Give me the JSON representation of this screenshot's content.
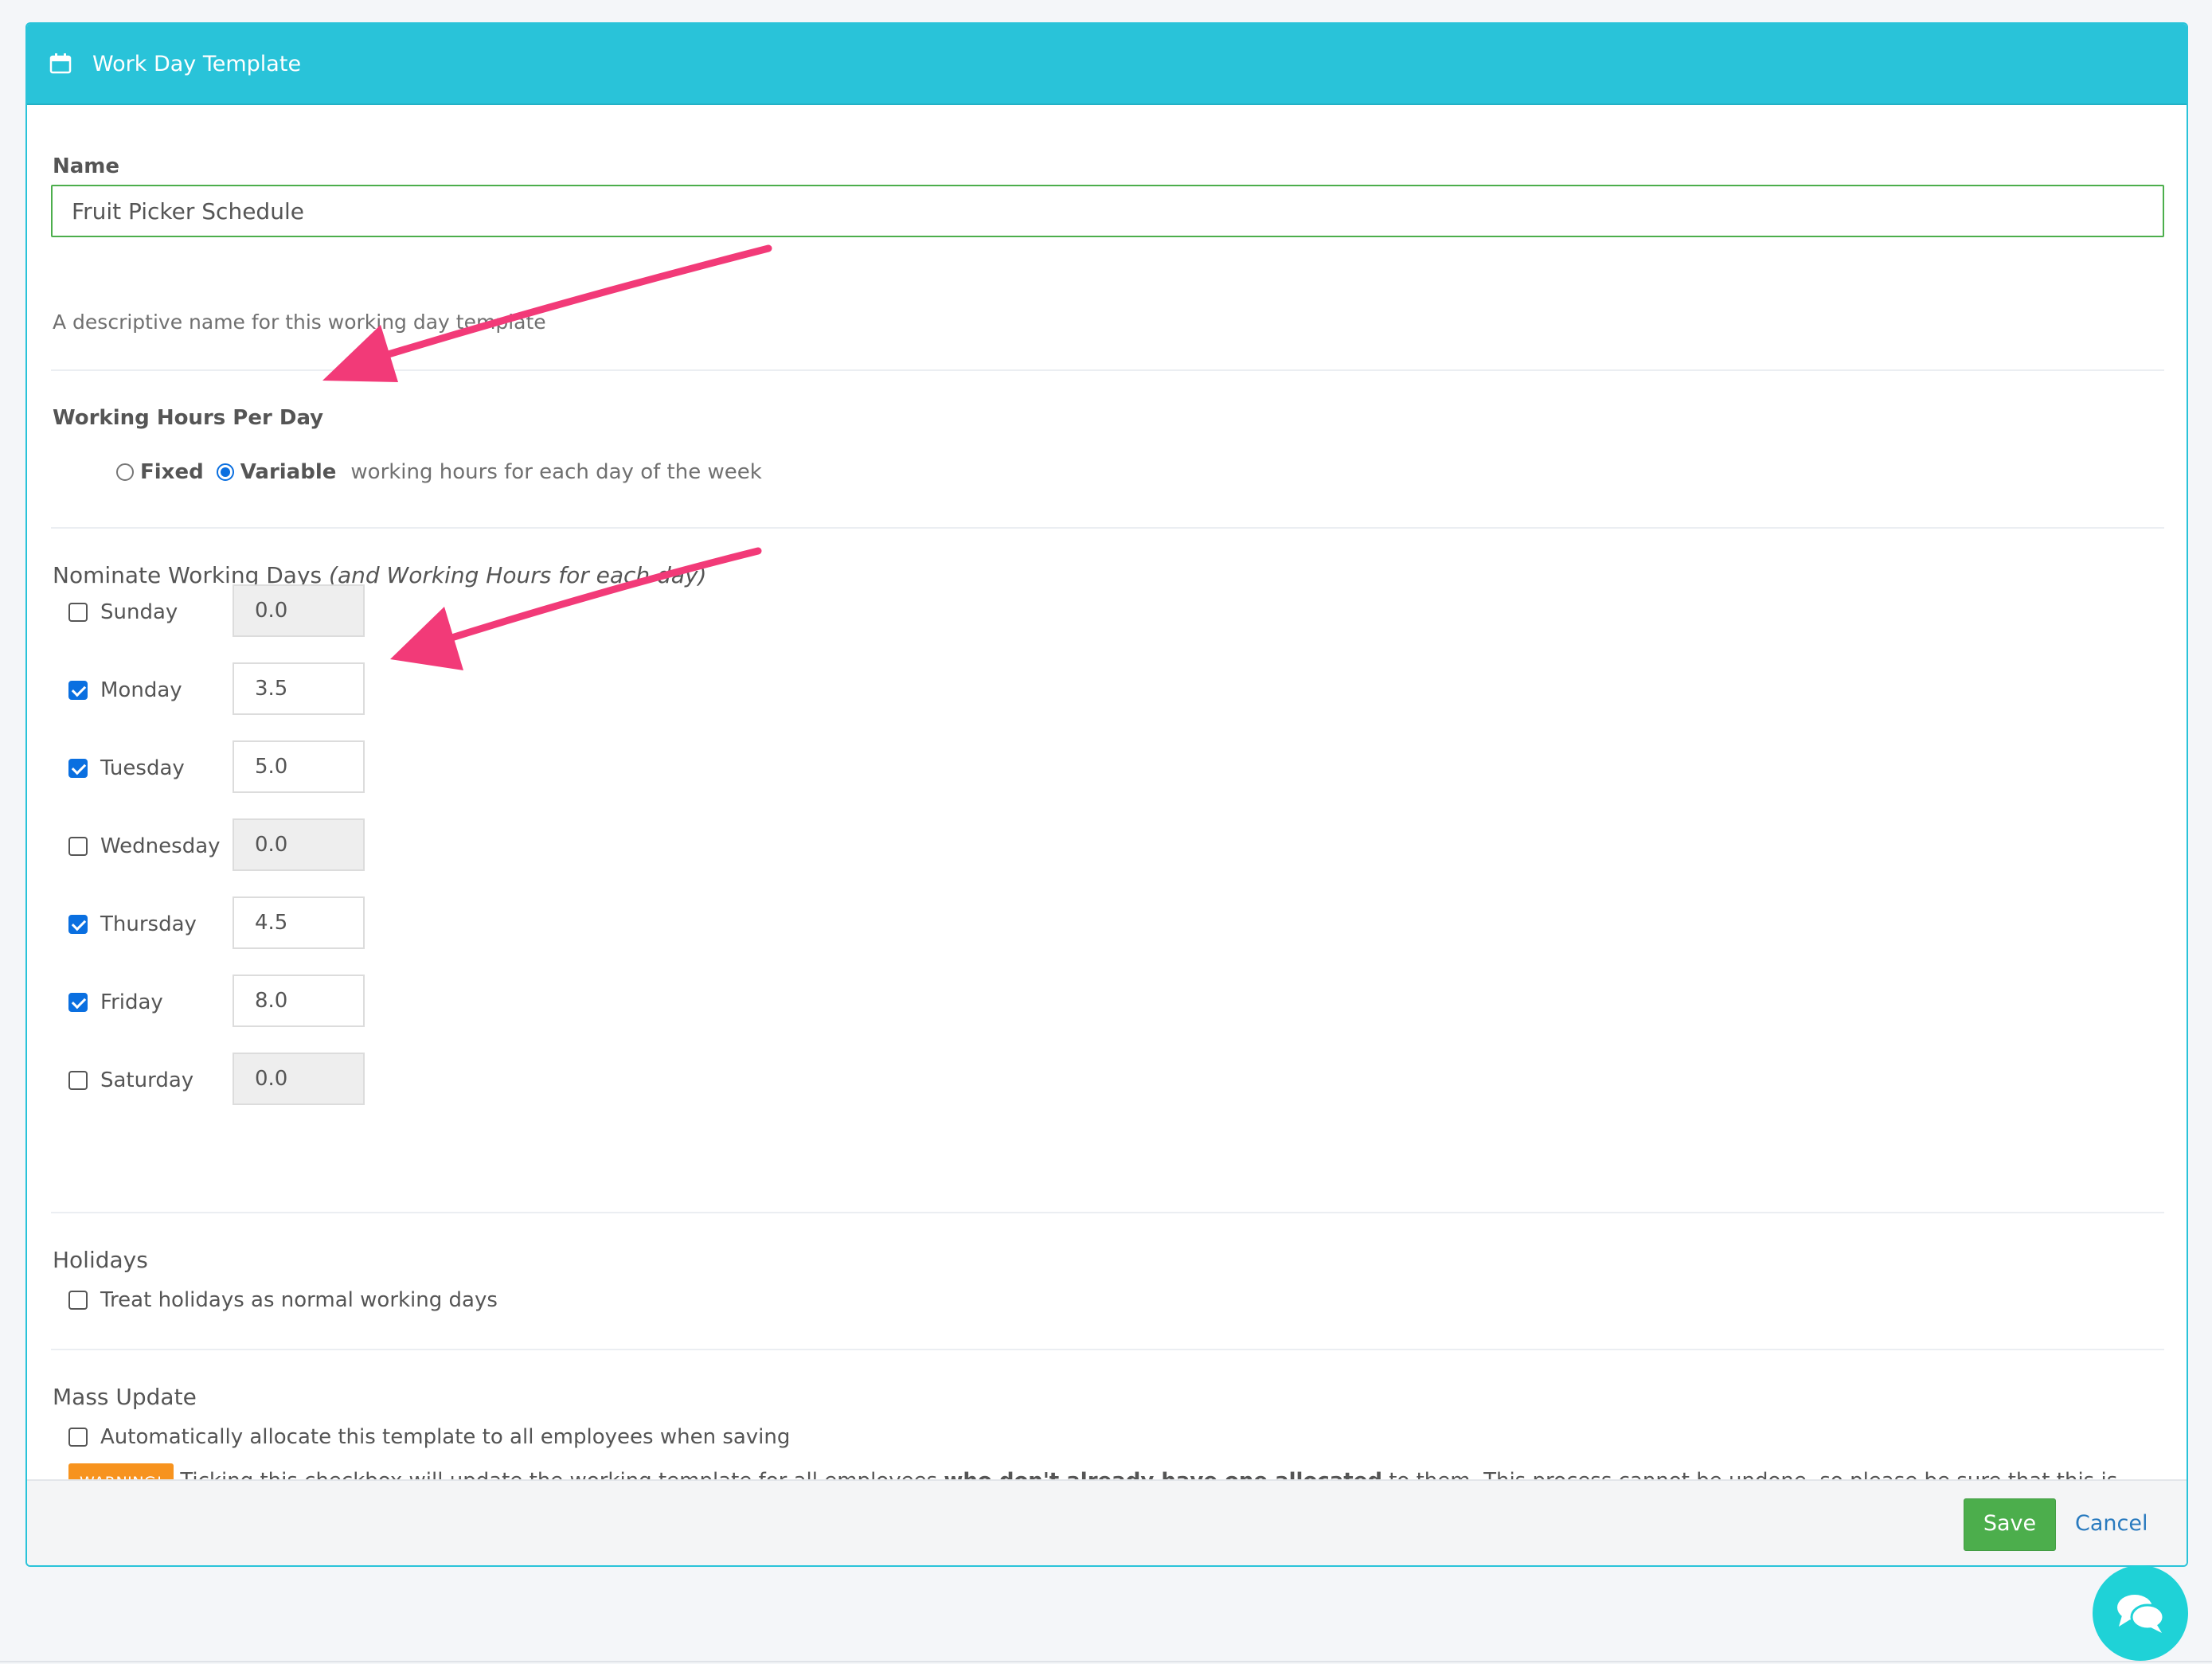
{
  "header": {
    "title": "Work Day Template",
    "icon": "calendar-icon"
  },
  "name_field": {
    "label": "Name",
    "value": "Fruit Picker Schedule",
    "hint": "A descriptive name for this working day template"
  },
  "working_hours": {
    "label": "Working Hours Per Day",
    "options": [
      {
        "label": "Fixed",
        "checked": false
      },
      {
        "label": "Variable",
        "checked": true
      }
    ],
    "suffix": "working hours for each day of the week"
  },
  "working_days": {
    "title": "Nominate Working Days",
    "title_suffix": "(and Working Hours for each day)",
    "days": [
      {
        "label": "Sunday",
        "checked": false,
        "hours": "0.0"
      },
      {
        "label": "Monday",
        "checked": true,
        "hours": "3.5"
      },
      {
        "label": "Tuesday",
        "checked": true,
        "hours": "5.0"
      },
      {
        "label": "Wednesday",
        "checked": false,
        "hours": "0.0"
      },
      {
        "label": "Thursday",
        "checked": true,
        "hours": "4.5"
      },
      {
        "label": "Friday",
        "checked": true,
        "hours": "8.0"
      },
      {
        "label": "Saturday",
        "checked": false,
        "hours": "0.0"
      }
    ]
  },
  "holidays": {
    "title": "Holidays",
    "checkbox_label": "Treat holidays as normal working days",
    "checked": false
  },
  "mass_update": {
    "title": "Mass Update",
    "checkbox_label": "Automatically allocate this template to all employees when saving",
    "checked": false,
    "warning_badge": "WARNING!",
    "warning_text_1": "Ticking this checkbox will update the working template for all employees ",
    "warning_text_bold": "who don't already have one allocated",
    "warning_text_2": " to them. This process cannot be undone, so please be sure that this is what you intend to do."
  },
  "footer": {
    "save_label": "Save",
    "cancel_label": "Cancel"
  },
  "colors": {
    "header_bg": "#29c3d9",
    "save_bg": "#4cae4c",
    "link": "#2a7bbf",
    "checkbox_checked": "#0a6fe0",
    "warning": "#f7931e",
    "annotation_arrow": "#f23a78",
    "chat_bubble": "#1fd2d7"
  },
  "chat": {
    "icon": "chat-bubbles-icon"
  }
}
